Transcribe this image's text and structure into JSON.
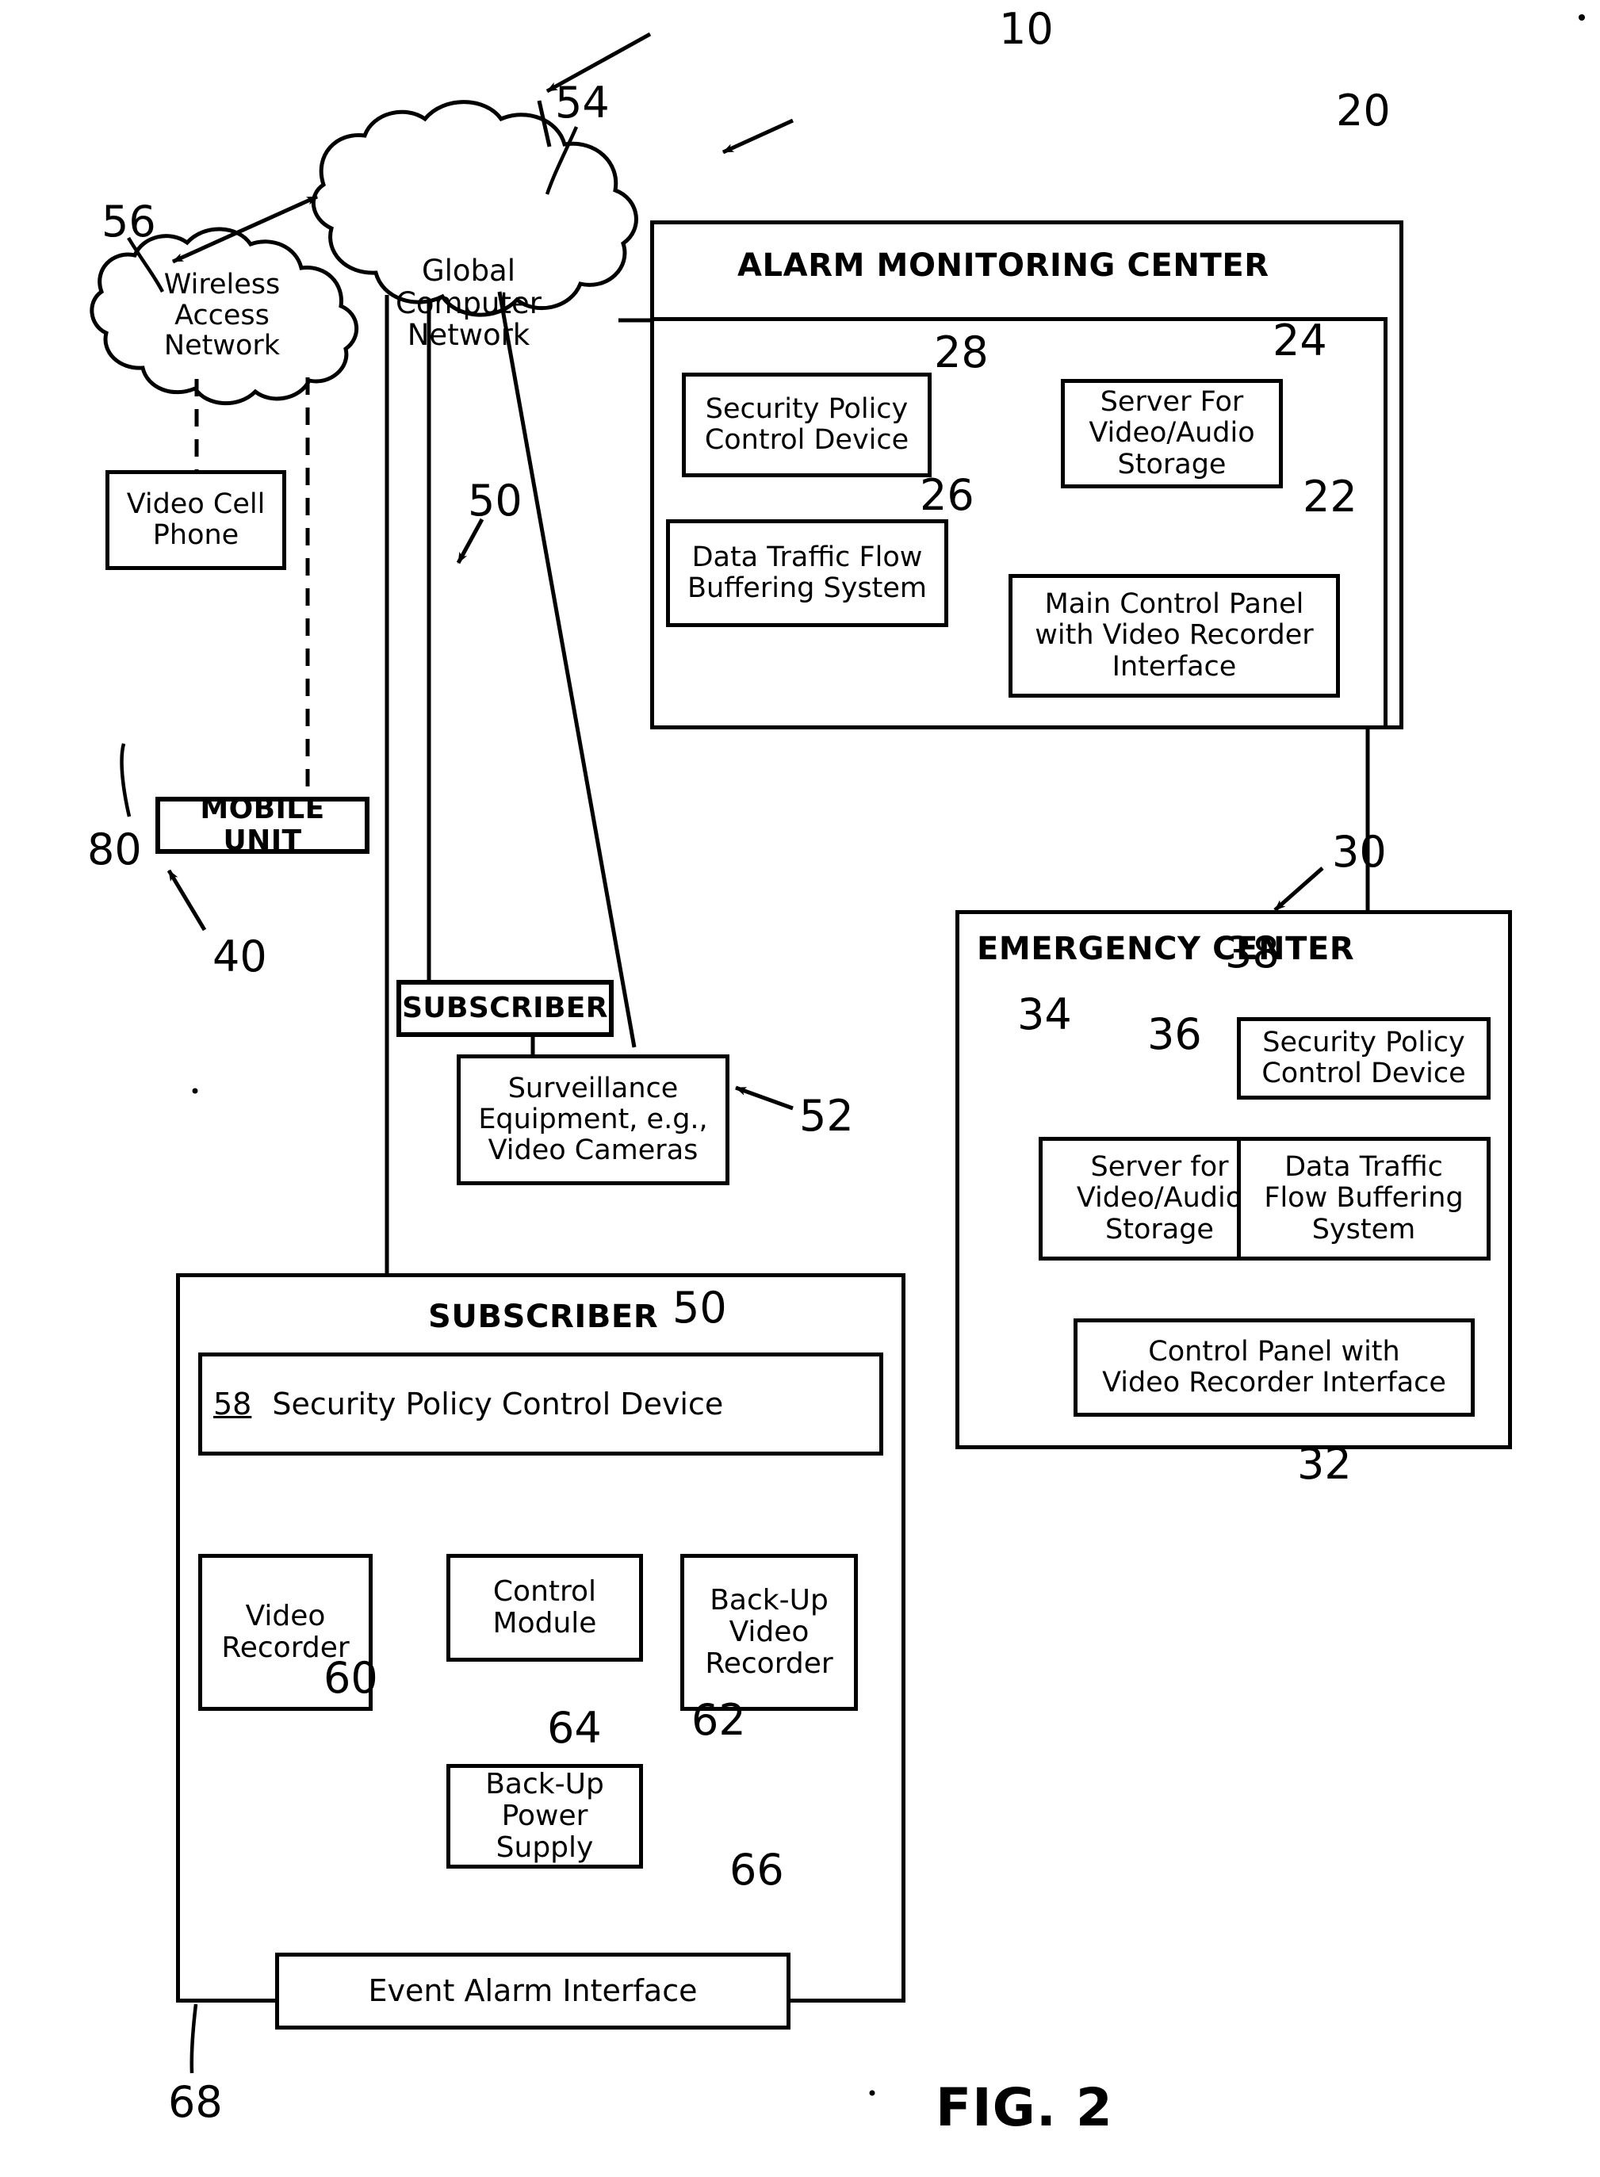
{
  "figure": {
    "label": "FIG. 2",
    "system_ref": "10"
  },
  "clouds": [
    {
      "id": "global-computer-network",
      "text": "Global\nComputer\nNetwork",
      "ref": "54"
    },
    {
      "id": "wireless-access-network",
      "text": "Wireless\nAccess\nNetwork",
      "ref": "56"
    }
  ],
  "alarm_monitoring_center": {
    "title": "ALARM MONITORING CENTER",
    "ref": "20",
    "boxes": [
      {
        "name": "security-policy-control-device",
        "text": "Security Policy\nControl Device",
        "ref": "28"
      },
      {
        "name": "server-for-video-audio-storage",
        "text": "Server For\nVideo/Audio\nStorage",
        "ref": "24"
      },
      {
        "name": "data-traffic-flow-buffering-system",
        "text": "Data Traffic Flow\nBuffering System",
        "ref": "26"
      },
      {
        "name": "main-control-panel",
        "text": "Main Control Panel\nwith Video Recorder\nInterface",
        "ref": "22"
      }
    ]
  },
  "emergency_center": {
    "title": "EMERGENCY CENTER",
    "ref": "30",
    "bottom_ref": "32",
    "boxes": [
      {
        "name": "security-policy-control-device",
        "text": "Security Policy\nControl Device",
        "ref": "38"
      },
      {
        "name": "server-for-video-audio-storage",
        "text": "Server for\nVideo/Audio\nStorage",
        "ref": "34"
      },
      {
        "name": "data-traffic-flow-buffering-system",
        "text": "Data Traffic\nFlow Buffering\nSystem",
        "ref": "36"
      },
      {
        "name": "control-panel",
        "text": "Control Panel with\nVideo Recorder Interface",
        "ref": "32"
      }
    ]
  },
  "mobile_unit": {
    "title": "MOBILE UNIT",
    "ref": "40",
    "video_cell_phone": {
      "text": "Video Cell\nPhone",
      "ref": "80"
    }
  },
  "subscriber_small": {
    "title": "SUBSCRIBER",
    "ref": "50",
    "surveillance": {
      "text": "Surveillance\nEquipment, e.g.,\nVideo Cameras",
      "ref": "52"
    }
  },
  "subscriber_main": {
    "title": "SUBSCRIBER",
    "ref": "50",
    "security_policy": {
      "ref": "58",
      "text": "Security Policy Control Device"
    },
    "boxes": [
      {
        "name": "video-recorder",
        "text": "Video\nRecorder",
        "ref": "60"
      },
      {
        "name": "control-module",
        "text": "Control\nModule",
        "ref": "64"
      },
      {
        "name": "back-up-video-recorder",
        "text": "Back-Up\nVideo\nRecorder",
        "ref": "62"
      },
      {
        "name": "back-up-power-supply",
        "text": "Back-Up\nPower\nSupply",
        "ref": "66"
      },
      {
        "name": "event-alarm-interface",
        "text": "Event Alarm Interface",
        "ref": "68"
      }
    ]
  },
  "colors": {
    "ink": "#000000",
    "paper": "#ffffff"
  }
}
